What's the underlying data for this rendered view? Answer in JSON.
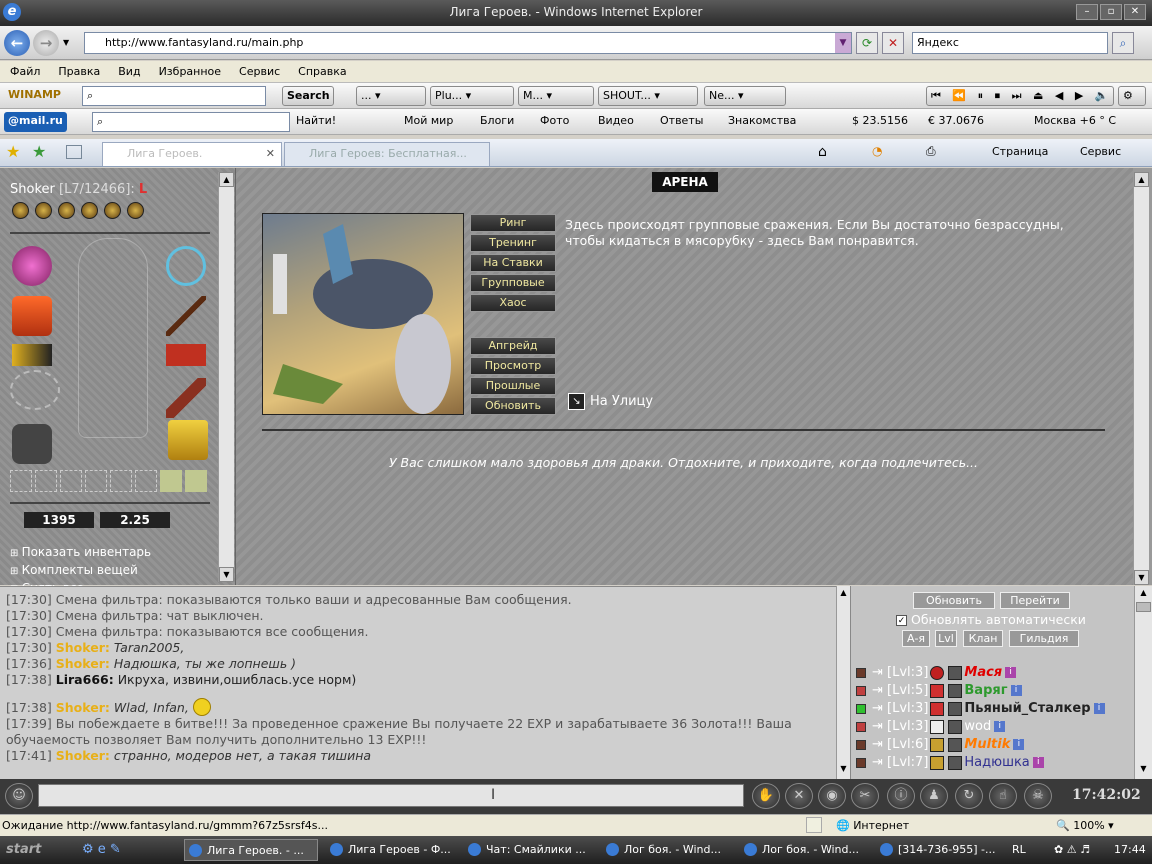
{
  "window": {
    "title": "Лига Героев. - Windows Internet Explorer"
  },
  "address": {
    "url": "http://www.fantasyland.ru/main.php",
    "search_value": "Яндекс"
  },
  "menu": [
    "Файл",
    "Правка",
    "Вид",
    "Избранное",
    "Сервис",
    "Справка"
  ],
  "toolbar1": {
    "winamp": "WINAMP",
    "search_btn": "Search",
    "items": [
      "...",
      "Plu...",
      "M...",
      "SHOUT...",
      "Ne..."
    ]
  },
  "toolbar2": {
    "mail": "@mail.ru",
    "find_btn": "Найти!",
    "links": [
      "Мой мир",
      "Блоги",
      "Фото",
      "Видео",
      "Ответы",
      "Знакомства"
    ],
    "usd": "$ 23.5156",
    "eur": "€ 37.0676",
    "weather": "Москва +6 ° С"
  },
  "tabs": {
    "tab1": "Лига Героев.",
    "tab2": "Лига Героев: Бесплатная...",
    "page_menu": "Страница",
    "tools_menu": "Сервис"
  },
  "player": {
    "name": "Shoker",
    "level": "[L7/12466]:",
    "gold": "1395",
    "gems": "2.25"
  },
  "inventory_links": [
    "Показать инвентарь",
    "Комплекты вещей",
    "Снять все"
  ],
  "arena": {
    "title": "АРЕНА",
    "buttons_top": [
      "Ринг",
      "Тренинг",
      "На Ставки",
      "Групповые",
      "Хаос"
    ],
    "buttons_bottom": [
      "Апгрейд",
      "Просмотр",
      "Прошлые",
      "Обновить"
    ],
    "description": "Здесь происходят групповые сражения. Если Вы достаточно безрассудны, чтобы кидаться в мясорубку - здесь Вам понравится.",
    "street": "На Улицу",
    "warning": "У Вас слишком мало здоровья для драки. Отдохните, и приходите, когда подлечитесь..."
  },
  "chat": {
    "lines": [
      {
        "time": "[17:30]",
        "nick": "",
        "text": "Смена фильтра: показываются только ваши и адресованные Вам сообщения."
      },
      {
        "time": "[17:30]",
        "nick": "",
        "text": "Смена фильтра: чат выключен."
      },
      {
        "time": "[17:30]",
        "nick": "",
        "text": "Смена фильтра: показываются все сообщения."
      },
      {
        "time": "[17:30]",
        "nick": "Shoker:",
        "text": "Taran2005,"
      },
      {
        "time": "[17:36]",
        "nick": "Shoker:",
        "text": "Надюшка, ты же лопнешь )"
      },
      {
        "time": "[17:38]",
        "nick": "Lira666:",
        "text": "Икруха, извини,ошиблась.усе норм)"
      },
      {
        "time": "[17:38]",
        "nick": "Shoker:",
        "text": "Wlad, Infan,"
      },
      {
        "time": "[17:39]",
        "nick": "",
        "text": "Вы побеждаете в битве!!! За проведенное сражение Вы получаете 22 EXP и зарабатываете 36 Золота!!! Ваша обучаемость позволяет Вам получить дополнительно 13 EXP!!!"
      },
      {
        "time": "[17:41]",
        "nick": "Shoker:",
        "text": "странно, модеров нет, а такая тишина"
      }
    ]
  },
  "online": {
    "refresh": "Обновить",
    "goto": "Перейти",
    "auto": "Обновлять автоматически",
    "sort": [
      "А-я",
      "Lvl",
      "Клан",
      "Гильдия"
    ],
    "users": [
      {
        "lvl": "[Lvl:3]",
        "name": "Мася",
        "color": "#e00000"
      },
      {
        "lvl": "[Lvl:5]",
        "name": "Варяг",
        "color": "#2e9a2e"
      },
      {
        "lvl": "[Lvl:3]",
        "name": "Пьяный_Сталкер",
        "color": "#222222"
      },
      {
        "lvl": "[Lvl:3]",
        "name": "wod",
        "color": "#ffffff"
      },
      {
        "lvl": "[Lvl:6]",
        "name": "Multik",
        "color": "#ff7a00"
      },
      {
        "lvl": "[Lvl:7]",
        "name": "Надюшка",
        "color": "#303090"
      }
    ]
  },
  "clock": "17:42:02",
  "status": {
    "loading": "Ожидание http://www.fantasyland.ru/gmmm?67z5srsf4s...",
    "zone": "Интернет",
    "zoom": "100%"
  },
  "taskbar": {
    "start": "start",
    "tasks": [
      "Лига Героев. - ...",
      "Лига Героев - Ф...",
      "Чат: Смайлики ...",
      "Лог боя. - Wind...",
      "Лог боя. - Wind...",
      "[314-736-955] -..."
    ],
    "lang": "RL",
    "time": "17:44"
  }
}
